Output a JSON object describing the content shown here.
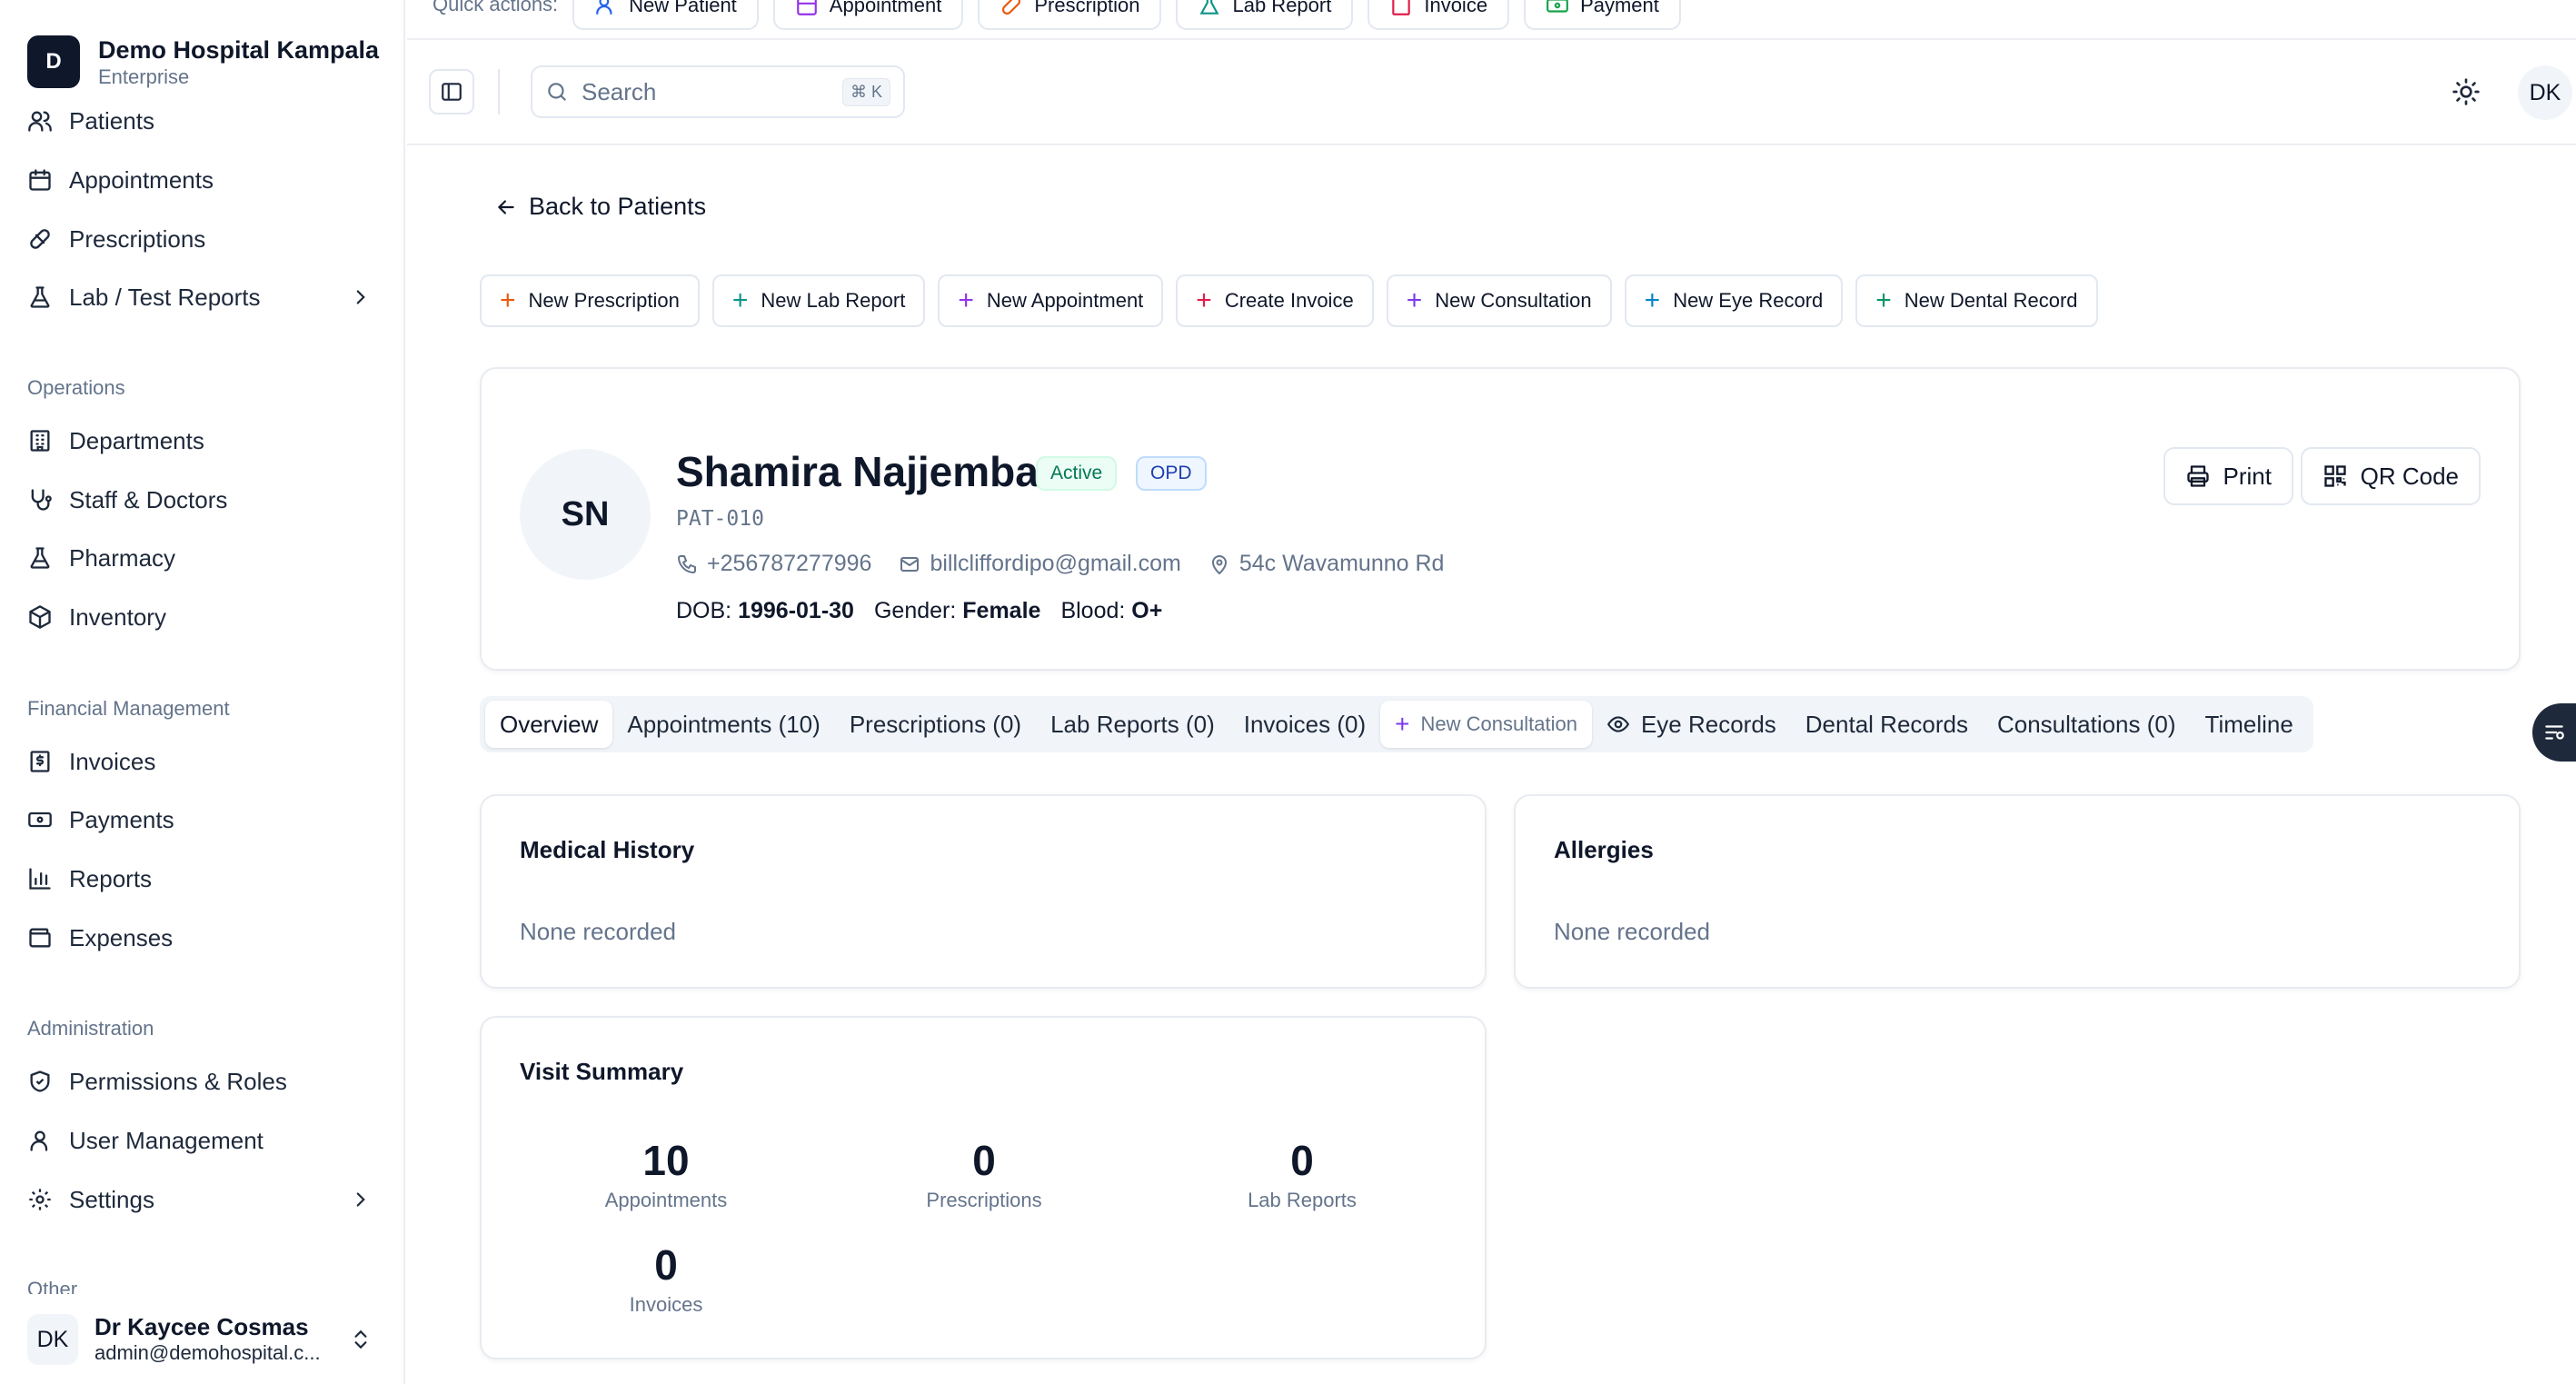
{
  "brand": {
    "logo_letter": "D",
    "name": "Demo Hospital Kampala",
    "plan": "Enterprise"
  },
  "sidebar": {
    "items_top": [
      {
        "label": "Patients",
        "icon": "users-icon"
      },
      {
        "label": "Appointments",
        "icon": "calendar-icon"
      },
      {
        "label": "Prescriptions",
        "icon": "pill-icon"
      },
      {
        "label": "Lab / Test Reports",
        "icon": "flask-icon",
        "expandable": true
      }
    ],
    "operations_label": "Operations",
    "operations": [
      {
        "label": "Departments",
        "icon": "building-icon"
      },
      {
        "label": "Staff & Doctors",
        "icon": "stethoscope-icon"
      },
      {
        "label": "Pharmacy",
        "icon": "flask-icon"
      },
      {
        "label": "Inventory",
        "icon": "package-icon"
      }
    ],
    "financial_label": "Financial Management",
    "financial": [
      {
        "label": "Invoices",
        "icon": "receipt-icon"
      },
      {
        "label": "Payments",
        "icon": "banknote-icon"
      },
      {
        "label": "Reports",
        "icon": "bar-chart-icon"
      },
      {
        "label": "Expenses",
        "icon": "wallet-icon"
      }
    ],
    "admin_label": "Administration",
    "admin": [
      {
        "label": "Permissions & Roles",
        "icon": "shield-icon"
      },
      {
        "label": "User Management",
        "icon": "user-icon"
      },
      {
        "label": "Settings",
        "icon": "gear-icon",
        "expandable": true
      }
    ],
    "other_label": "Other"
  },
  "user": {
    "initials": "DK",
    "name": "Dr Kaycee Cosmas",
    "email": "admin@demohospital.c..."
  },
  "quickbar": {
    "label": "Quick actions:",
    "buttons": [
      {
        "label": "New Patient",
        "color": "#2563eb"
      },
      {
        "label": "Appointment",
        "color": "#9333ea"
      },
      {
        "label": "Prescription",
        "color": "#ea580c"
      },
      {
        "label": "Lab Report",
        "color": "#0d9488"
      },
      {
        "label": "Invoice",
        "color": "#e11d48"
      },
      {
        "label": "Payment",
        "color": "#16a34a"
      }
    ]
  },
  "header": {
    "search_placeholder": "Search",
    "search_shortcut": "⌘ K",
    "avatar": "DK"
  },
  "main": {
    "back_label": "Back to Patients",
    "actions": [
      {
        "label": "New Prescription",
        "color": "#ea580c"
      },
      {
        "label": "New Lab Report",
        "color": "#0d9488"
      },
      {
        "label": "New Appointment",
        "color": "#9333ea"
      },
      {
        "label": "Create Invoice",
        "color": "#e11d48"
      },
      {
        "label": "New Consultation",
        "color": "#7c3aed"
      },
      {
        "label": "New Eye Record",
        "color": "#0284c7"
      },
      {
        "label": "New Dental Record",
        "color": "#059669"
      }
    ],
    "patient": {
      "initials": "SN",
      "name": "Shamira Najjemba",
      "status_badge": "Active",
      "type_badge": "OPD",
      "id": "PAT-010",
      "phone": "+256787277996",
      "email": "billcliffordipo@gmail.com",
      "address": "54c Wavamunno Rd",
      "dob_label": "DOB:",
      "dob": "1996-01-30",
      "gender_label": "Gender:",
      "gender": "Female",
      "blood_label": "Blood:",
      "blood": "O+",
      "print_label": "Print",
      "qr_label": "QR Code"
    },
    "tabs": [
      {
        "label": "Overview",
        "active": true
      },
      {
        "label": "Appointments (10)"
      },
      {
        "label": "Prescriptions (0)"
      },
      {
        "label": "Lab Reports (0)"
      },
      {
        "label": "Invoices (0)"
      },
      {
        "label": "New Consultation",
        "button": true
      },
      {
        "label": "Eye Records",
        "icon": "eye-icon"
      },
      {
        "label": "Dental Records"
      },
      {
        "label": "Consultations (0)"
      },
      {
        "label": "Timeline"
      }
    ],
    "medical_history": {
      "title": "Medical History",
      "value": "None recorded"
    },
    "allergies": {
      "title": "Allergies",
      "value": "None recorded"
    },
    "visit_summary": {
      "title": "Visit Summary",
      "stats": [
        {
          "value": "10",
          "label": "Appointments"
        },
        {
          "value": "0",
          "label": "Prescriptions"
        },
        {
          "value": "0",
          "label": "Lab Reports"
        },
        {
          "value": "0",
          "label": "Invoices"
        }
      ]
    }
  }
}
